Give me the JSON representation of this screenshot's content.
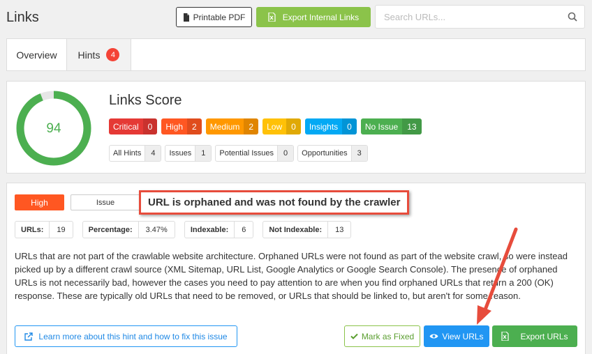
{
  "header": {
    "title": "Links",
    "printable_pdf": "Printable PDF",
    "export_internal": "Export Internal Links",
    "search_placeholder": "Search URLs..."
  },
  "tabs": [
    {
      "label": "Overview"
    },
    {
      "label": "Hints",
      "count": "4"
    }
  ],
  "score": {
    "title": "Links Score",
    "value": "94",
    "percent": 94,
    "severities": [
      {
        "label": "Critical",
        "count": "0",
        "color": "#e53935"
      },
      {
        "label": "High",
        "count": "2",
        "color": "#ff5722"
      },
      {
        "label": "Medium",
        "count": "2",
        "color": "#ff9800"
      },
      {
        "label": "Low",
        "count": "0",
        "color": "#ffc107"
      },
      {
        "label": "Insights",
        "count": "0",
        "color": "#03a9f4"
      },
      {
        "label": "No Issue",
        "count": "13",
        "color": "#4caf50"
      }
    ],
    "filters": [
      {
        "label": "All Hints",
        "count": "4"
      },
      {
        "label": "Issues",
        "count": "1"
      },
      {
        "label": "Potential Issues",
        "count": "0"
      },
      {
        "label": "Opportunities",
        "count": "3"
      }
    ]
  },
  "hint": {
    "priority": "High",
    "type": "Issue",
    "title": "URL is orphaned and was not found by the crawler",
    "stats": [
      {
        "label": "URLs:",
        "value": "19"
      },
      {
        "label": "Percentage:",
        "value": "3.47%"
      },
      {
        "label": "Indexable:",
        "value": "6"
      },
      {
        "label": "Not Indexable:",
        "value": "13"
      }
    ],
    "description": "URLs that are not part of the crawlable website architecture. Orphaned URLs were not found as part of the website crawl, so were instead picked up by a different crawl source (XML Sitemap, URL List, Google Analytics or Google Search Console). The presence of orphaned URLs is not necessarily bad, however the cases you need to pay attention to are when you find orphaned URLs that return a 200 (OK) response. These are typically old URLs that need to be removed, or URLs that should be linked to, but aren't for some reason.",
    "learn_more": "Learn more about this hint and how to fix this issue",
    "mark_fixed": "Mark as Fixed",
    "view_urls": "View URLs",
    "export_urls": "Export URLs"
  },
  "colors": {
    "accent_green": "#4caf50",
    "accent_blue": "#2196f3",
    "annotation_red": "#e74c3c"
  }
}
